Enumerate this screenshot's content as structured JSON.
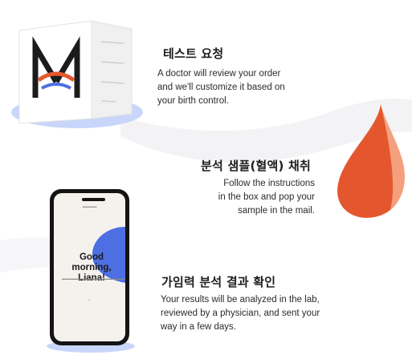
{
  "steps": [
    {
      "title": "테스트 요청",
      "description": "A doctor will review your order\nand we'll customize it based on\nyour birth control."
    },
    {
      "title": "분석 샘플(혈액) 채취",
      "description": "Follow the instructions\nin the box and pop your\nsample in the mail."
    },
    {
      "title": "가임력 분석 결과 확인",
      "description": "Your results will be analyzed in the lab,\nreviewed by a physician, and sent your\nway in a few days."
    }
  ],
  "phone_screen": {
    "greeting": "Good morning,\nLiana!"
  },
  "colors": {
    "drop_main": "#e4572e",
    "drop_light": "#f4a07e",
    "accent_blue": "#4e6fe3",
    "shadow_blue": "#c9d6fb"
  }
}
